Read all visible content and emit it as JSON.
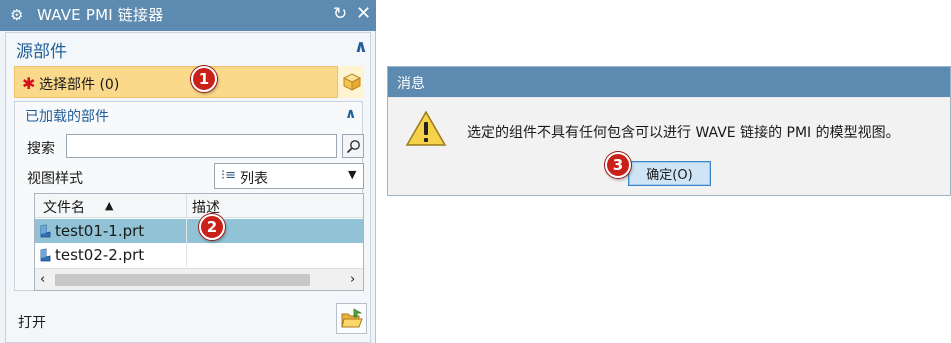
{
  "dialog": {
    "title": "WAVE PMI 链接器",
    "source_section": {
      "title": "源部件",
      "select_part_label": "选择部件 (0)",
      "required_mark": "✱"
    },
    "loaded_section": {
      "title": "已加载的部件",
      "search_label": "搜索",
      "search_value": "",
      "view_style_label": "视图样式",
      "view_style_value": "列表",
      "table": {
        "columns": [
          "文件名",
          "描述"
        ],
        "rows": [
          {
            "name": "test01-1.prt",
            "description": "",
            "selected": true
          },
          {
            "name": "test02-2.prt",
            "description": "",
            "selected": false
          }
        ]
      }
    },
    "open_label": "打开"
  },
  "callouts": [
    "1",
    "2",
    "3"
  ],
  "message_dialog": {
    "title": "消息",
    "text": "选定的组件不具有任何包含可以进行 WAVE 链接的 PMI 的模型视图。",
    "ok_label": "确定(O)"
  },
  "colors": {
    "title_bar": "#5c8ab0",
    "selection_highlight": "#fbd98a",
    "selected_row": "#91c2d5",
    "callout_badge": "#c9211a",
    "section_text": "#23609b"
  }
}
